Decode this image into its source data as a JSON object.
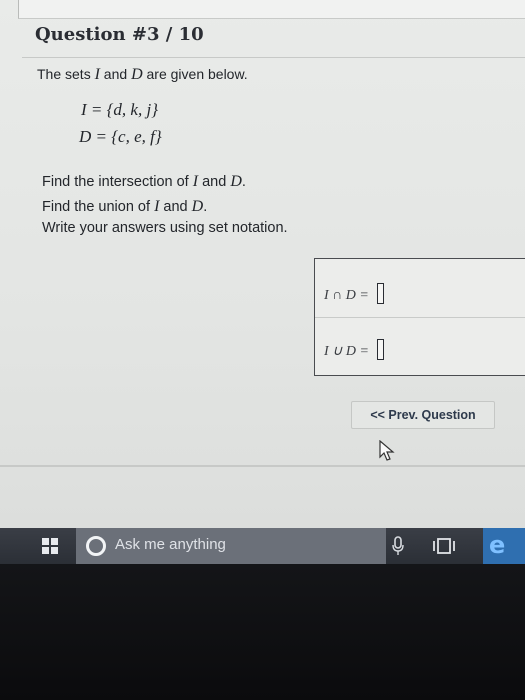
{
  "question": {
    "label": "Question #3 / 10",
    "intro": [
      "The sets ",
      "I",
      " and ",
      "D",
      " are given below."
    ],
    "set_I": "I = {d, k, j}",
    "set_D": "D = {c, e, f}",
    "instructions": [
      [
        "Find the intersection of ",
        "I",
        " and ",
        "D",
        "."
      ],
      [
        "Find the union of ",
        "I",
        " and ",
        "D",
        "."
      ],
      [
        "Write your answers using set notation.",
        "",
        "",
        "",
        ""
      ]
    ]
  },
  "answers": {
    "intersection_label": "I ∩ D =",
    "intersection_value": "",
    "union_label": "I ∪ D =",
    "union_value": ""
  },
  "nav": {
    "prev_label": "<< Prev. Question"
  },
  "taskbar": {
    "search_placeholder": "Ask me anything",
    "icons": [
      "windows-icon",
      "cortana-icon",
      "microphone-icon",
      "task-view-icon",
      "edge-icon"
    ]
  },
  "colors": {
    "taskbar": "#2b2f36",
    "search": "#6b7079",
    "edge": "#2f6fb0"
  }
}
